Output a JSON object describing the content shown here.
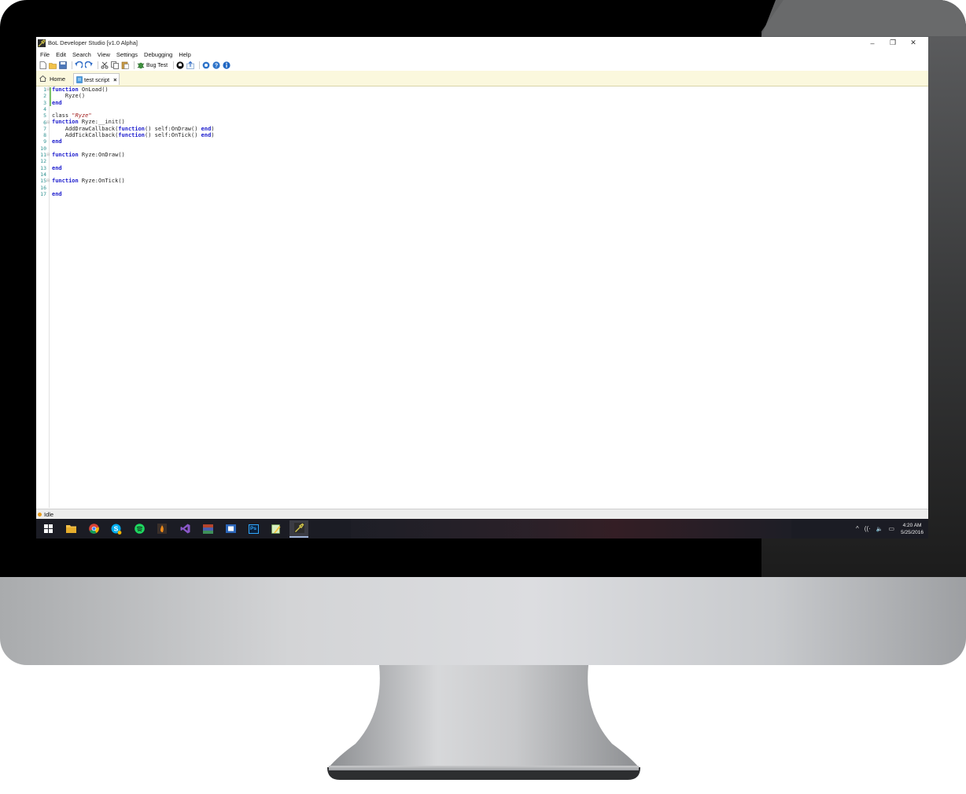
{
  "window": {
    "title": "BoL Developer Studio [v1.0 Alpha]",
    "controls": {
      "minimize": "–",
      "restore": "❐",
      "close": "✕"
    }
  },
  "menu": [
    "File",
    "Edit",
    "Search",
    "View",
    "Settings",
    "Debugging",
    "Help"
  ],
  "toolbar": {
    "bug_test_label": "Bug Test",
    "icons": [
      "new-file-icon",
      "open-folder-icon",
      "save-icon",
      "undo-icon",
      "redo-icon",
      "cut-icon",
      "copy-icon",
      "paste-icon",
      "bug-icon",
      "github-icon",
      "export-icon",
      "settings-icon",
      "help-icon",
      "info-icon"
    ]
  },
  "tabs": {
    "home": {
      "label": "Home",
      "icon": "home-icon"
    },
    "active": {
      "label": "test script",
      "icon": "script-icon",
      "close": "×"
    }
  },
  "editor": {
    "line_numbers": [
      "1",
      "2",
      "3",
      "4",
      "5",
      "6",
      "7",
      "8",
      "9",
      "10",
      "11",
      "12",
      "13",
      "14",
      "15",
      "16",
      "17"
    ],
    "lines": [
      [
        {
          "t": "kw",
          "v": "function"
        },
        {
          "t": "id",
          "v": " OnLoad()"
        }
      ],
      [
        {
          "t": "id",
          "v": "    Ryze()"
        }
      ],
      [
        {
          "t": "kw",
          "v": "end"
        }
      ],
      [],
      [
        {
          "t": "id",
          "v": "class "
        },
        {
          "t": "str",
          "v": "\"Ryze\""
        }
      ],
      [
        {
          "t": "kw",
          "v": "function"
        },
        {
          "t": "id",
          "v": " Ryze:__init()"
        }
      ],
      [
        {
          "t": "id",
          "v": "    AddDrawCallback("
        },
        {
          "t": "kw",
          "v": "function"
        },
        {
          "t": "id",
          "v": "() self:OnDraw() "
        },
        {
          "t": "kw",
          "v": "end"
        },
        {
          "t": "id",
          "v": ")"
        }
      ],
      [
        {
          "t": "id",
          "v": "    AddTickCallback("
        },
        {
          "t": "kw",
          "v": "function"
        },
        {
          "t": "id",
          "v": "() self:OnTick() "
        },
        {
          "t": "kw",
          "v": "end"
        },
        {
          "t": "id",
          "v": ")"
        }
      ],
      [
        {
          "t": "kw",
          "v": "end"
        }
      ],
      [],
      [
        {
          "t": "kw",
          "v": "function"
        },
        {
          "t": "id",
          "v": " Ryze:OnDraw()"
        }
      ],
      [],
      [
        {
          "t": "kw",
          "v": "end"
        }
      ],
      [],
      [
        {
          "t": "kw",
          "v": "function"
        },
        {
          "t": "id",
          "v": " Ryze:OnTick()"
        }
      ],
      [],
      [
        {
          "t": "kw",
          "v": "end"
        }
      ]
    ]
  },
  "status": {
    "text": "Idle",
    "color": "#e89c1a"
  },
  "taskbar": {
    "apps": [
      "windows-start-icon",
      "file-explorer-icon",
      "chrome-icon",
      "skype-icon",
      "spotify-icon",
      "app-flame-icon",
      "visual-studio-icon",
      "winrar-icon",
      "media-player-icon",
      "photoshop-icon",
      "notepad-icon",
      "bol-studio-icon"
    ],
    "photoshop_label": "Ps",
    "tray": {
      "chevron": "^",
      "wifi": "((·",
      "volume": "🔈",
      "notifications": "▭"
    },
    "time": "4:20 AM",
    "date": "5/25/2016"
  },
  "colors": {
    "keyword": "#1a1acd",
    "string": "#a32020",
    "line_numbers": "#2b8f8f",
    "tab_strip": "#fbf8dd",
    "taskbar": "#1b1c24"
  }
}
